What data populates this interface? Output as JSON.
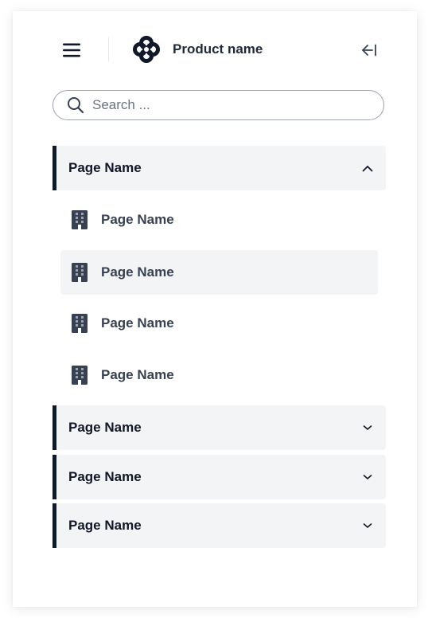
{
  "header": {
    "product_name": "Product name",
    "menu_icon": "hamburger-menu-icon",
    "logo_icon": "four-petal-logo-icon",
    "collapse_icon": "arrow-left-to-bar-icon"
  },
  "search": {
    "placeholder": "Search ...",
    "value": "",
    "icon": "search-icon"
  },
  "nav": {
    "groups": [
      {
        "label": "Page Name",
        "expanded": true,
        "items": [
          {
            "label": "Page Name",
            "icon": "building-icon",
            "active": false
          },
          {
            "label": "Page Name",
            "icon": "building-icon",
            "active": true
          },
          {
            "label": "Page Name",
            "icon": "building-icon",
            "active": false
          },
          {
            "label": "Page Name",
            "icon": "building-icon",
            "active": false
          }
        ]
      },
      {
        "label": "Page Name",
        "expanded": false
      },
      {
        "label": "Page Name",
        "expanded": false
      },
      {
        "label": "Page Name",
        "expanded": false
      }
    ]
  },
  "colors": {
    "accent": "#111827",
    "group_background": "#f3f4f6",
    "icon": "#374151"
  }
}
